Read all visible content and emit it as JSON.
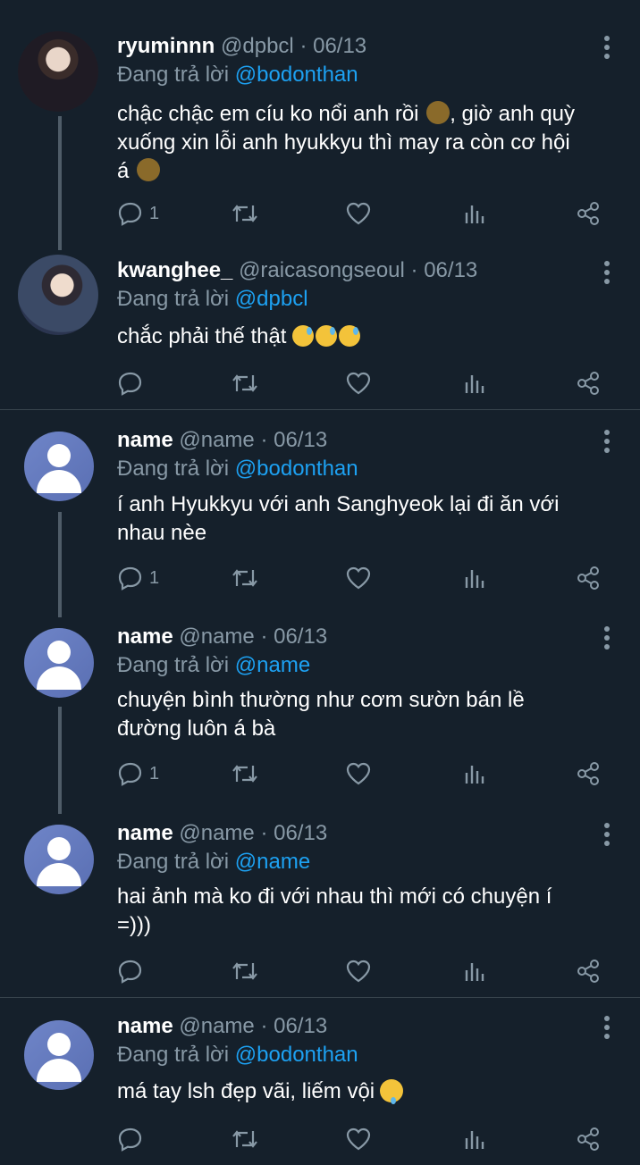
{
  "tweets": [
    {
      "name": "ryuminnn",
      "handle": "@dpbcl",
      "date": "· 06/13",
      "reply_prefix": "Đang trả lời",
      "reply_to": "@bodonthan",
      "text_lines": [
        "chậc chậc em cíu ko nổi anh rồi",
        "xuống xin lỗi anh hyukkyu thì may ra còn cơ hội",
        "á"
      ],
      "text_after_emoji": ", giờ anh quỳ",
      "reply_count": "1"
    },
    {
      "name": "kwanghee_",
      "handle": "@raicasongseoul",
      "date": "· 06/13",
      "reply_prefix": "Đang trả lời",
      "reply_to": "@dpbcl",
      "text_lines": [
        "chắc phải thế thật"
      ],
      "reply_count": ""
    },
    {
      "name": "name",
      "handle": "@name",
      "date": "· 06/13",
      "reply_prefix": "Đang trả lời",
      "reply_to": "@bodonthan",
      "text_lines": [
        "í anh Hyukkyu với anh Sanghyeok lại đi ăn với",
        "nhau nèe"
      ],
      "reply_count": "1"
    },
    {
      "name": "name",
      "handle": "@name",
      "date": "· 06/13",
      "reply_prefix": "Đang trả lời",
      "reply_to": "@name",
      "text_lines": [
        "chuyện bình thường như cơm sườn bán lề",
        "đường luôn á bà"
      ],
      "reply_count": "1"
    },
    {
      "name": "name",
      "handle": "@name",
      "date": "· 06/13",
      "reply_prefix": "Đang trả lời",
      "reply_to": "@name",
      "text_lines": [
        "hai ảnh mà ko đi với nhau thì mới có chuyện í",
        "=)))"
      ],
      "reply_count": ""
    },
    {
      "name": "name",
      "handle": "@name",
      "date": "· 06/13",
      "reply_prefix": "Đang trả lời",
      "reply_to": "@bodonthan",
      "text_lines": [
        "má tay lsh đẹp vãi, liếm vội"
      ],
      "reply_count": ""
    }
  ],
  "icons": [
    "reply-icon",
    "retweet-icon",
    "like-icon",
    "analytics-icon",
    "share-icon",
    "more-icon"
  ],
  "colors": {
    "background": "#15202b",
    "text": "#ffffff",
    "muted": "#8899a6",
    "mention": "#1da1f2",
    "divider": "#38444d"
  }
}
